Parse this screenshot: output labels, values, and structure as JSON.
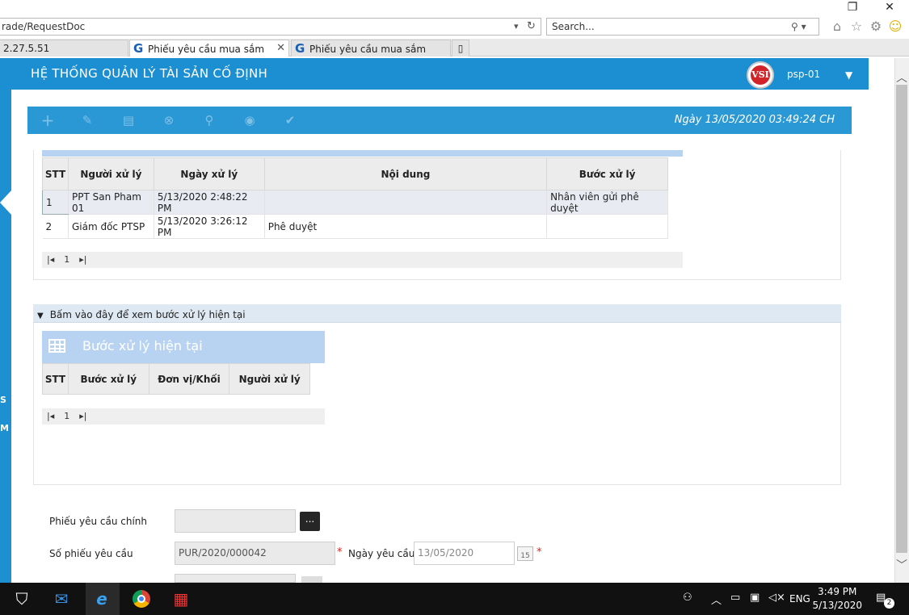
{
  "browser": {
    "address": "rade/RequestDoc",
    "search_placeholder": "Search...",
    "tabs": [
      {
        "label": "2.27.5.51"
      },
      {
        "label": "Phiếu yêu cầu mua sắm"
      },
      {
        "label": "Phiếu yêu cầu mua sắm"
      }
    ],
    "window_buttons": {
      "restore": "❐",
      "close": "✕"
    }
  },
  "app": {
    "title": "HỆ THỐNG QUẢN LÝ TÀI SẢN CỐ ĐỊNH",
    "user": "psp-01",
    "logo_text": "VSI",
    "left_labels": [
      "S",
      "M"
    ],
    "colors": {
      "header": "#1b8fd2",
      "toolbar": "#2a98d4",
      "panel_blue": "#b8d3f1"
    }
  },
  "toolbar": {
    "icons": [
      "plus-icon",
      "pencil-icon",
      "save-icon",
      "cancel-icon",
      "search-icon",
      "eye-icon",
      "check-icon"
    ],
    "datetime": "Ngày 13/05/2020   03:49:24 CH"
  },
  "history": {
    "columns": [
      "STT",
      "Người xử lý",
      "Ngày xử lý",
      "Nội dung",
      "Bước xử lý"
    ],
    "rows": [
      {
        "stt": "1",
        "user": "PPT San Pham 01",
        "date": "5/13/2020 2:48:22 PM",
        "content": "",
        "step": "Nhân viên gửi phê duyệt"
      },
      {
        "stt": "2",
        "user": "Giám đốc PTSP",
        "date": "5/13/2020 3:26:12 PM",
        "content": "Phê duyệt",
        "step": ""
      }
    ],
    "page": "1"
  },
  "current_step": {
    "toggle_label": "Bấm vào đây để xem bước xử lý hiện tại",
    "title": "Bước xử lý hiện tại",
    "columns": [
      "STT",
      "Bước xử lý",
      "Đơn vị/Khối",
      "Người xử lý"
    ],
    "page": "1"
  },
  "form": {
    "main_request_label": "Phiếu yêu cầu chính",
    "main_request_value": "",
    "browse_label": "...",
    "request_no_label": "Số phiếu yêu cầu",
    "request_no_value": "PUR/2020/000042",
    "request_date_label": "Ngày yêu cầu",
    "request_date_value": "13/05/2020",
    "calendar_day": "15"
  },
  "taskbar": {
    "time": "3:49 PM",
    "date": "5/13/2020",
    "language": "ENG",
    "notifications": "2"
  }
}
